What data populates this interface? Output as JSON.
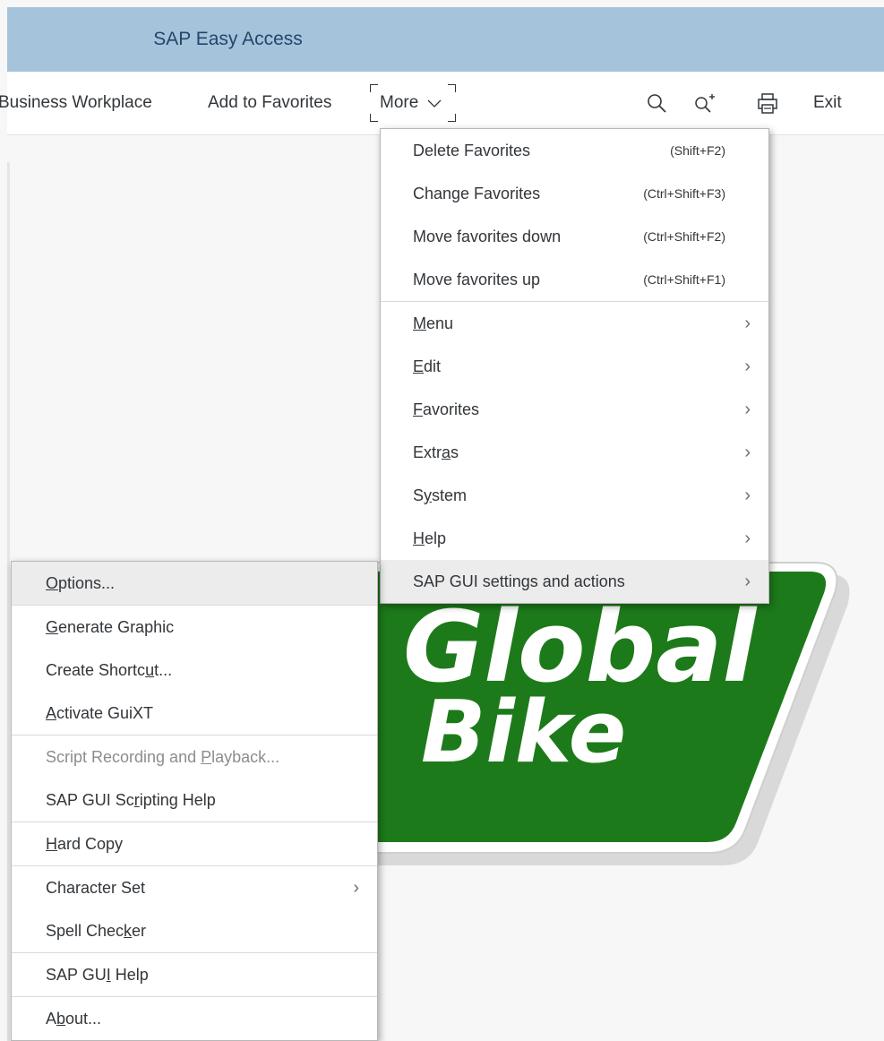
{
  "window": {
    "title": "SAP Easy Access"
  },
  "toolbar": {
    "business_workplace": "Business Workplace",
    "add_to_favorites": "Add to Favorites",
    "more": "More",
    "exit": "Exit",
    "icons": [
      "search-icon",
      "search-plus-icon",
      "print-icon"
    ]
  },
  "more_menu": {
    "items": [
      {
        "label": "Delete Favorites",
        "shortcut": "(Shift+F2)"
      },
      {
        "label": "Change Favorites",
        "shortcut": "(Ctrl+Shift+F3)"
      },
      {
        "label": "Move favorites down",
        "shortcut": "(Ctrl+Shift+F2)"
      },
      {
        "label": "Move favorites up",
        "shortcut": "(Ctrl+Shift+F1)"
      },
      {
        "label": "Menu",
        "submenu": true,
        "mnemonic": "M"
      },
      {
        "label": "Edit",
        "submenu": true,
        "mnemonic": "E"
      },
      {
        "label": "Favorites",
        "submenu": true,
        "mnemonic": "F"
      },
      {
        "label": "Extras",
        "submenu": true,
        "mnemonic": "a"
      },
      {
        "label": "System",
        "submenu": true,
        "mnemonic": "y"
      },
      {
        "label": "Help",
        "submenu": true,
        "mnemonic": "H"
      },
      {
        "label": "SAP GUI settings and actions",
        "submenu": true,
        "highlighted": true
      }
    ]
  },
  "gui_menu": {
    "items": [
      {
        "label": "Options...",
        "highlighted": true
      },
      {
        "label": "Generate Graphic"
      },
      {
        "label": "Create Shortcut..."
      },
      {
        "label": "Activate GuiXT"
      },
      {
        "label": "Script Recording and Playback...",
        "disabled": true
      },
      {
        "label": "SAP GUI Scripting Help"
      },
      {
        "label": "Hard Copy"
      },
      {
        "label": "Character Set",
        "submenu": true
      },
      {
        "label": "Spell Checker"
      },
      {
        "label": "SAP GUI Help"
      },
      {
        "label": "About..."
      }
    ]
  },
  "logo": {
    "line1": "Global",
    "line2": "Bike",
    "color": "#1d7a1a"
  }
}
